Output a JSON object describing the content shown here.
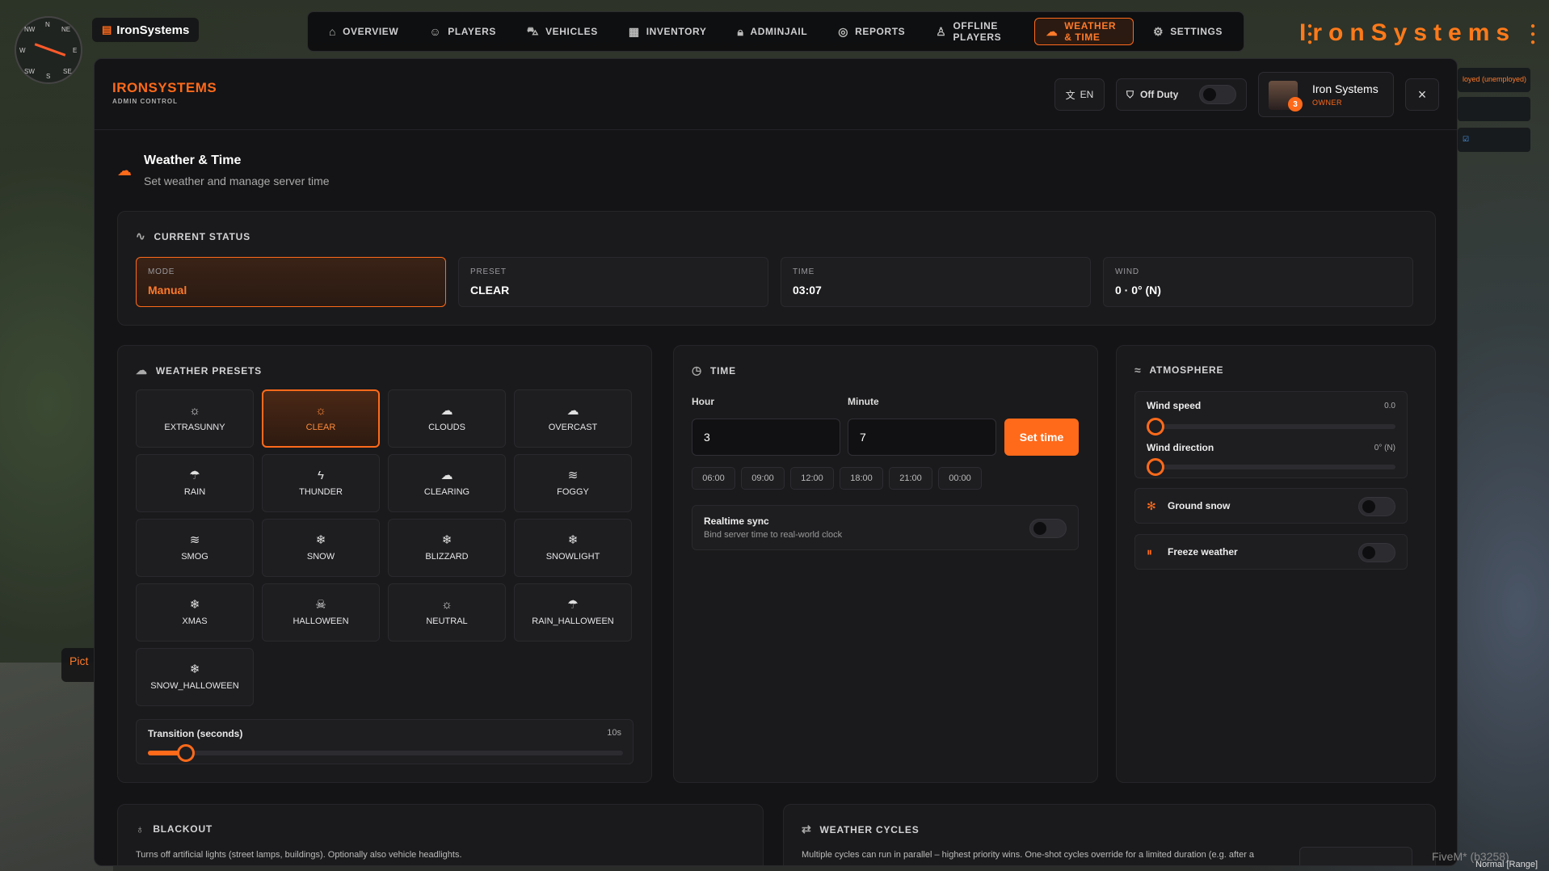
{
  "hud": {
    "compass": {
      "n": "N",
      "ne": "NE",
      "nw": "NW",
      "w": "W",
      "e": "E",
      "sw": "SW",
      "se": "SE",
      "s": "S"
    },
    "top_brand": "IronSystems",
    "brand_right": "IronSystems",
    "side_tab": "Pict",
    "right_status": "loyed (unemployed)",
    "fivem": "FiveM* (b3258)",
    "mode_text": "Normal [Range]"
  },
  "nav": {
    "items": [
      {
        "label": "OVERVIEW",
        "icon": "home-icon",
        "glyph": "⌂"
      },
      {
        "label": "PLAYERS",
        "icon": "users-icon",
        "glyph": "☺"
      },
      {
        "label": "VEHICLES",
        "icon": "car-icon",
        "glyph": "⛍"
      },
      {
        "label": "INVENTORY",
        "icon": "warehouse-icon",
        "glyph": "▦"
      },
      {
        "label": "ADMINJAIL",
        "icon": "lock-icon",
        "glyph": "🔒︎"
      },
      {
        "label": "REPORTS",
        "icon": "lifebuoy-icon",
        "glyph": "◎"
      },
      {
        "label": "OFFLINE PLAYERS",
        "icon": "user-off-icon",
        "glyph": "♙"
      },
      {
        "label": "WEATHER & TIME",
        "icon": "cloud-icon",
        "glyph": "☁",
        "active": true
      },
      {
        "label": "SETTINGS",
        "icon": "gear-icon",
        "glyph": "⚙"
      }
    ]
  },
  "header": {
    "logo_title": "IRONSYSTEMS",
    "logo_sub": "ADMIN CONTROL",
    "lang": "EN",
    "duty_label": "Off Duty",
    "user_name": "Iron Systems",
    "user_role": "OWNER",
    "user_badge": "3",
    "close": "×"
  },
  "page": {
    "title": "Weather & Time",
    "subtitle": "Set weather and manage server time"
  },
  "status": {
    "heading": "CURRENT STATUS",
    "mode": {
      "label": "MODE",
      "value": "Manual"
    },
    "preset": {
      "label": "PRESET",
      "value": "CLEAR"
    },
    "time": {
      "label": "TIME",
      "value": "03:07"
    },
    "wind": {
      "label": "WIND",
      "value": "0 · 0° (N)"
    }
  },
  "presets": {
    "heading": "WEATHER PRESETS",
    "selected": "CLEAR",
    "items": [
      {
        "label": "EXTRASUNNY",
        "glyph": "☼"
      },
      {
        "label": "CLEAR",
        "glyph": "☼"
      },
      {
        "label": "CLOUDS",
        "glyph": "☁"
      },
      {
        "label": "OVERCAST",
        "glyph": "☁"
      },
      {
        "label": "RAIN",
        "glyph": "☂"
      },
      {
        "label": "THUNDER",
        "glyph": "ϟ"
      },
      {
        "label": "CLEARING",
        "glyph": "☁"
      },
      {
        "label": "FOGGY",
        "glyph": "≋"
      },
      {
        "label": "SMOG",
        "glyph": "≋"
      },
      {
        "label": "SNOW",
        "glyph": "❄"
      },
      {
        "label": "BLIZZARD",
        "glyph": "❄"
      },
      {
        "label": "SNOWLIGHT",
        "glyph": "❄"
      },
      {
        "label": "XMAS",
        "glyph": "❄"
      },
      {
        "label": "HALLOWEEN",
        "glyph": "☠"
      },
      {
        "label": "NEUTRAL",
        "glyph": "☼"
      },
      {
        "label": "RAIN_HALLOWEEN",
        "glyph": "☂"
      },
      {
        "label": "SNOW_HALLOWEEN",
        "glyph": "❄"
      }
    ],
    "transition_label": "Transition (seconds)",
    "transition_value": "10s",
    "transition_fraction": 0.08
  },
  "time": {
    "heading": "TIME",
    "hour_label": "Hour",
    "hour_value": "3",
    "minute_label": "Minute",
    "minute_value": "7",
    "set_button": "Set time",
    "quick": [
      "06:00",
      "09:00",
      "12:00",
      "18:00",
      "21:00",
      "00:00"
    ],
    "realtime_label": "Realtime sync",
    "realtime_sub": "Bind server time to real-world clock"
  },
  "atmosphere": {
    "heading": "ATMOSPHERE",
    "wind_speed_label": "Wind speed",
    "wind_speed_value": "0.0",
    "wind_dir_label": "Wind direction",
    "wind_dir_value": "0° (N)",
    "ground_snow": "Ground snow",
    "freeze": "Freeze weather"
  },
  "blackout": {
    "heading": "BLACKOUT",
    "desc": "Turns off artificial lights (street lamps, buildings). Optionally also vehicle headlights."
  },
  "cycles": {
    "heading": "WEATHER CYCLES",
    "desc": "Multiple cycles can run in parallel – highest priority wins. One-shot cycles override for a limited duration (e.g. after a"
  },
  "colors": {
    "accent": "#ff6a1a",
    "panel": "#141416",
    "card": "#1a1a1c"
  }
}
